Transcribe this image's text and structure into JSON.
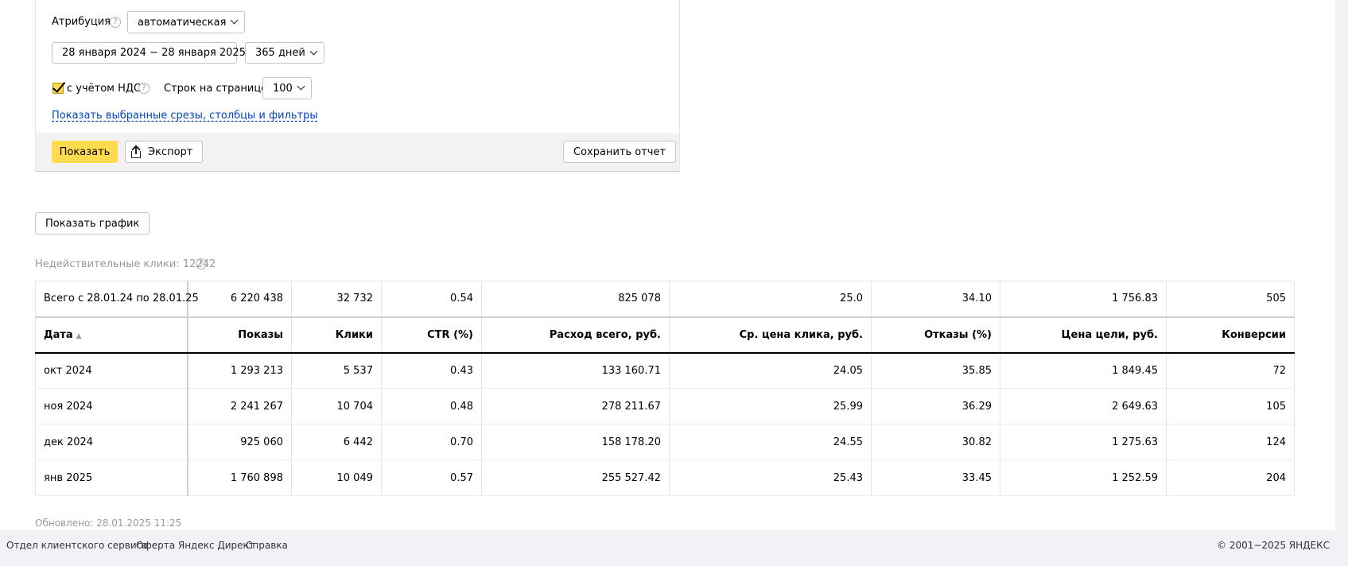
{
  "filters": {
    "attribution_label": "Атрибуция",
    "attribution_value": "автоматическая",
    "date_range": "28 января 2024 − 28 января 2025",
    "period_value": "365 дней",
    "vat_label": "с учётом НДС",
    "rows_per_page_label": "Строк на странице",
    "rows_per_page_value": "100",
    "show_selected_link": "Показать выбранные срезы, столбцы и фильтры",
    "help_glyph": "?"
  },
  "actions": {
    "show_label": "Показать",
    "export_label": "Экспорт",
    "save_report_label": "Сохранить отчет"
  },
  "show_chart_label": "Показать график",
  "invalid_clicks": "Недействительные клики: 12242",
  "table": {
    "total": [
      "Всего с 28.01.24 по 28.01.25",
      "6 220 438",
      "32 732",
      "0.54",
      "825 078",
      "25.0",
      "34.10",
      "1 756.83",
      "505"
    ],
    "headers": [
      "Дата",
      "Показы",
      "Клики",
      "CTR (%)",
      "Расход всего, руб.",
      "Ср. цена клика, руб.",
      "Отказы (%)",
      "Цена цели, руб.",
      "Конверсии"
    ],
    "sort_indicator": "▲",
    "rows": [
      [
        "окт 2024",
        "1 293 213",
        "5 537",
        "0.43",
        "133 160.71",
        "24.05",
        "35.85",
        "1 849.45",
        "72"
      ],
      [
        "ноя 2024",
        "2 241 267",
        "10 704",
        "0.48",
        "278 211.67",
        "25.99",
        "36.29",
        "2 649.63",
        "105"
      ],
      [
        "дек 2024",
        "925 060",
        "6 442",
        "0.70",
        "158 178.20",
        "24.55",
        "30.82",
        "1 275.63",
        "124"
      ],
      [
        "янв 2025",
        "1 760 898",
        "10 049",
        "0.57",
        "255 527.42",
        "25.43",
        "33.45",
        "1 252.59",
        "204"
      ]
    ]
  },
  "updated": "Обновлено: 28.01.2025 11:25",
  "footer": {
    "links": [
      "Отдел клиентского сервиса",
      "Оферта Яндекс Директ",
      "Справка"
    ],
    "copyright": "© 2001−2025 ЯНДЕКС"
  }
}
